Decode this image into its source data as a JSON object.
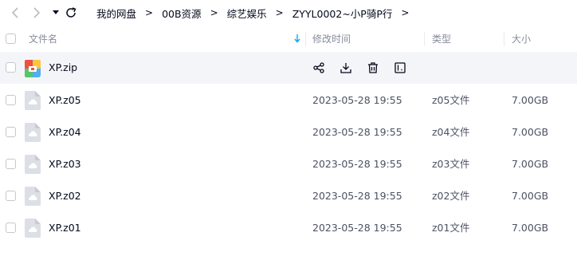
{
  "nav": {
    "breadcrumbs": [
      "我的网盘",
      "00B资源",
      "综艺娱乐",
      "ZYYL0002~小P骑P行"
    ],
    "separator": ">"
  },
  "columns": {
    "name": "文件名",
    "mtime": "修改时间",
    "type": "类型",
    "size": "大小"
  },
  "files": [
    {
      "name": "XP.zip",
      "mtime": "",
      "type": "",
      "size": "",
      "icon": "zip-archive-icon",
      "hover": true
    },
    {
      "name": "XP.z05",
      "mtime": "2023-05-28 19:55",
      "type": "z05文件",
      "size": "7.00GB",
      "icon": "cloud-file-icon"
    },
    {
      "name": "XP.z04",
      "mtime": "2023-05-28 19:55",
      "type": "z04文件",
      "size": "7.00GB",
      "icon": "cloud-file-icon"
    },
    {
      "name": "XP.z03",
      "mtime": "2023-05-28 19:55",
      "type": "z03文件",
      "size": "7.00GB",
      "icon": "cloud-file-icon"
    },
    {
      "name": "XP.z02",
      "mtime": "2023-05-28 19:55",
      "type": "z02文件",
      "size": "7.00GB",
      "icon": "cloud-file-icon"
    },
    {
      "name": "XP.z01",
      "mtime": "2023-05-28 19:55",
      "type": "z01文件",
      "size": "7.00GB",
      "icon": "cloud-file-icon"
    }
  ],
  "row_actions": [
    "share-icon",
    "download-icon",
    "delete-icon",
    "rename-icon"
  ],
  "colors": {
    "text": "#03081a",
    "muted": "#878c9c",
    "hover_row": "#f4f5f8",
    "accent": "#06a7ff"
  }
}
